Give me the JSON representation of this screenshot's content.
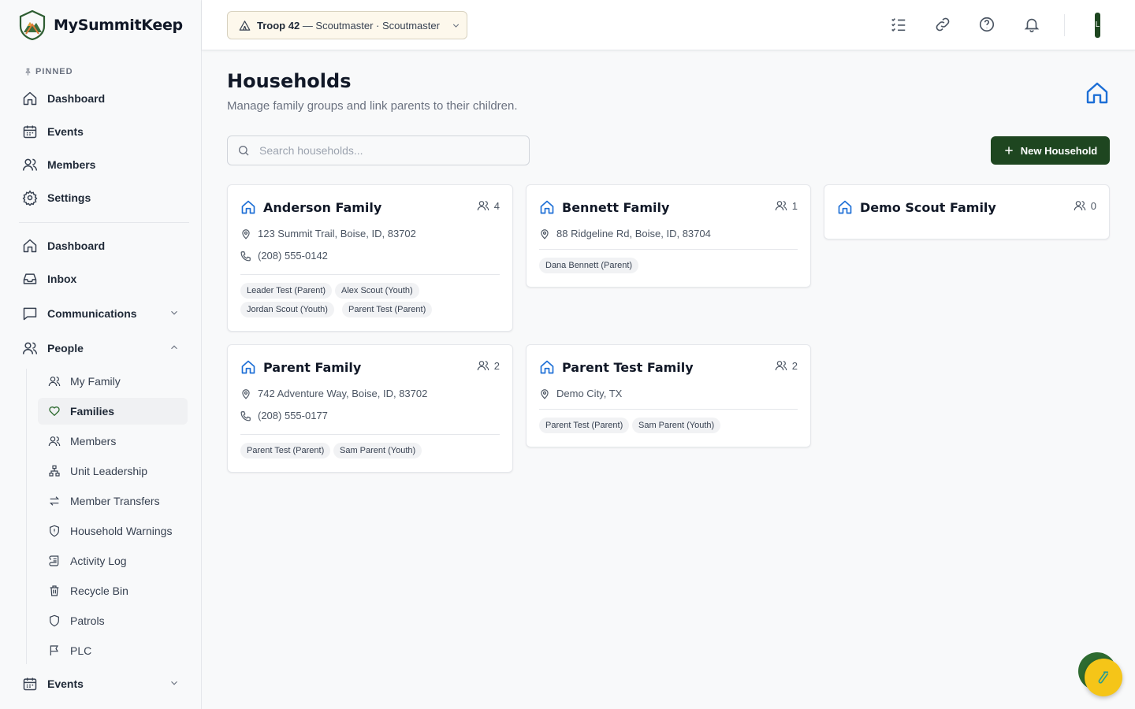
{
  "app": {
    "name": "MySummitKeep"
  },
  "sidebar": {
    "pinned_label": "PINNED",
    "pinned": [
      {
        "label": "Dashboard",
        "icon": "home-icon"
      },
      {
        "label": "Events",
        "icon": "calendar-icon"
      },
      {
        "label": "Members",
        "icon": "users-icon"
      },
      {
        "label": "Settings",
        "icon": "gear-icon"
      }
    ],
    "main": [
      {
        "label": "Dashboard",
        "icon": "home-icon"
      },
      {
        "label": "Inbox",
        "icon": "inbox-icon"
      },
      {
        "label": "Communications",
        "icon": "message-icon",
        "expanded": false
      },
      {
        "label": "People",
        "icon": "users-icon",
        "expanded": true
      }
    ],
    "people_items": [
      {
        "label": "My Family",
        "icon": "users-icon"
      },
      {
        "label": "Families",
        "icon": "heart-icon",
        "active": true
      },
      {
        "label": "Members",
        "icon": "users-icon"
      },
      {
        "label": "Unit Leadership",
        "icon": "org-chart-icon"
      },
      {
        "label": "Member Transfers",
        "icon": "transfer-icon"
      },
      {
        "label": "Household Warnings",
        "icon": "shield-alert-icon"
      },
      {
        "label": "Activity Log",
        "icon": "scroll-icon"
      },
      {
        "label": "Recycle Bin",
        "icon": "trash-icon"
      },
      {
        "label": "Patrols",
        "icon": "shield-icon"
      },
      {
        "label": "PLC",
        "icon": "flag-icon"
      }
    ],
    "events_section": {
      "label": "Events",
      "icon": "calendar-icon",
      "expanded": false
    }
  },
  "topbar": {
    "unit_name": "Troop 42",
    "unit_role": "— Scoutmaster · Scoutmaster",
    "avatar_initial": "L"
  },
  "page": {
    "title": "Households",
    "subtitle": "Manage family groups and link parents to their children.",
    "search_placeholder": "Search households...",
    "new_button": "New Household"
  },
  "households": [
    {
      "name": "Anderson Family",
      "count": "4",
      "address": "123 Summit Trail, Boise, ID, 83702",
      "phone": "(208) 555-0142",
      "members": [
        "Leader Test (Parent)",
        "Alex Scout (Youth)",
        "Jordan Scout (Youth)",
        "Parent Test (Parent)"
      ]
    },
    {
      "name": "Bennett Family",
      "count": "1",
      "address": "88 Ridgeline Rd, Boise, ID, 83704",
      "members": [
        "Dana Bennett (Parent)"
      ]
    },
    {
      "name": "Demo Scout Family",
      "count": "0"
    },
    {
      "name": "Parent Family",
      "count": "2",
      "address": "742 Adventure Way, Boise, ID, 83702",
      "phone": "(208) 555-0177",
      "members": [
        "Parent Test (Parent)",
        "Sam Parent (Youth)"
      ]
    },
    {
      "name": "Parent Test Family",
      "count": "2",
      "address": "Demo City, TX",
      "members": [
        "Parent Test (Parent)",
        "Sam Parent (Youth)"
      ]
    }
  ],
  "colors": {
    "brand_green": "#1e4620",
    "accent_blue": "#1d6fd6",
    "fab_yellow": "#f5c518"
  }
}
